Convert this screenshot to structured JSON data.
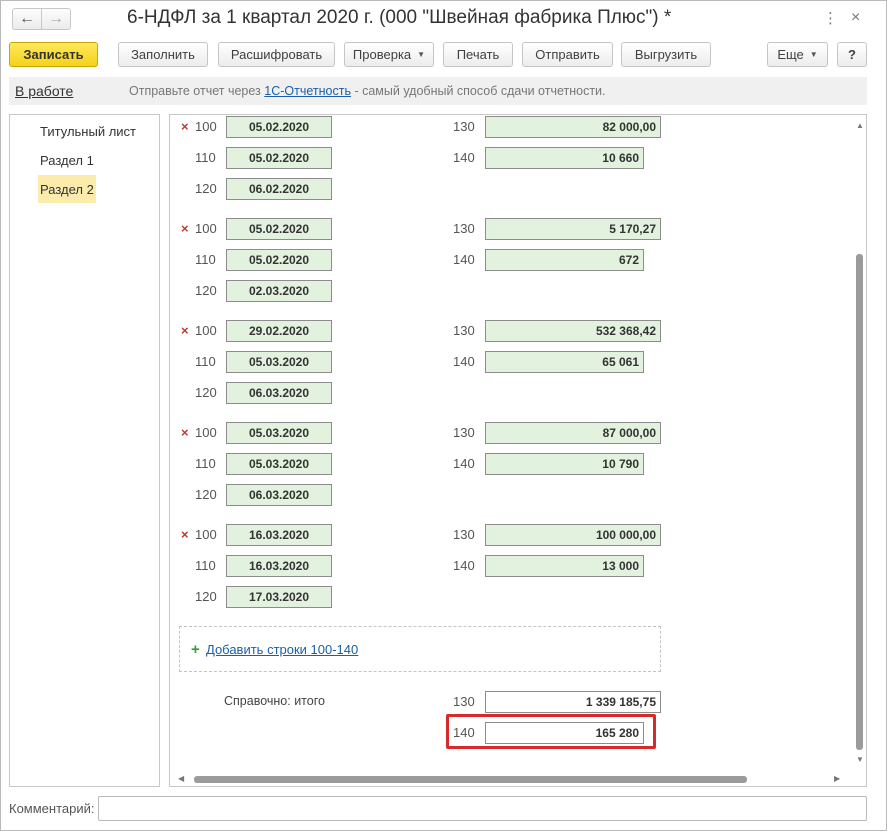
{
  "window": {
    "title": "6-НДФЛ за 1 квартал 2020 г. (000 \"Швейная фабрика Плюс\") *",
    "back_icon": "←",
    "forward_icon": "→",
    "menu_icon": "⋮",
    "close_icon": "×"
  },
  "toolbar": {
    "save": "Записать",
    "fill": "Заполнить",
    "decode": "Расшифровать",
    "check": "Проверка",
    "print": "Печать",
    "send": "Отправить",
    "export": "Выгрузить",
    "more": "Еще",
    "help": "?",
    "dropdown_caret": "▼"
  },
  "infobar": {
    "status": "В работе",
    "text_before": "Отправьте отчет через ",
    "link": "1С-Отчетность",
    "text_after": " - самый удобный способ сдачи отчетности."
  },
  "sections": [
    {
      "label": "Титульный лист",
      "active": false
    },
    {
      "label": "Раздел 1",
      "active": false
    },
    {
      "label": "Раздел 2",
      "active": true
    }
  ],
  "blocks": [
    {
      "line100_code": "100",
      "line100": "05.02.2020",
      "line110_code": "110",
      "line110": "05.02.2020",
      "line120_code": "120",
      "line120": "06.02.2020",
      "line130_code": "130",
      "line130": "82 000,00",
      "line140_code": "140",
      "line140": "10 660"
    },
    {
      "line100_code": "100",
      "line100": "05.02.2020",
      "line110_code": "110",
      "line110": "05.02.2020",
      "line120_code": "120",
      "line120": "02.03.2020",
      "line130_code": "130",
      "line130": "5 170,27",
      "line140_code": "140",
      "line140": "672"
    },
    {
      "line100_code": "100",
      "line100": "29.02.2020",
      "line110_code": "110",
      "line110": "05.03.2020",
      "line120_code": "120",
      "line120": "06.03.2020",
      "line130_code": "130",
      "line130": "532 368,42",
      "line140_code": "140",
      "line140": "65 061"
    },
    {
      "line100_code": "100",
      "line100": "05.03.2020",
      "line110_code": "110",
      "line110": "05.03.2020",
      "line120_code": "120",
      "line120": "06.03.2020",
      "line130_code": "130",
      "line130": "87 000,00",
      "line140_code": "140",
      "line140": "10 790"
    },
    {
      "line100_code": "100",
      "line100": "16.03.2020",
      "line110_code": "110",
      "line110": "16.03.2020",
      "line120_code": "120",
      "line120": "17.03.2020",
      "line130_code": "130",
      "line130": "100 000,00",
      "line140_code": "140",
      "line140": "13 000"
    }
  ],
  "delete_icon": "×",
  "add_rows": {
    "plus": "+",
    "label": "Добавить строки 100-140"
  },
  "totals": {
    "label": "Справочно: итого",
    "line130_code": "130",
    "line130": "1 339 185,75",
    "line140_code": "140",
    "line140": "165 280"
  },
  "scroll": {
    "up": "▲",
    "down": "▼",
    "left": "◀",
    "right": "▶"
  },
  "footer": {
    "comment_label": "Комментарий:",
    "comment_value": ""
  }
}
